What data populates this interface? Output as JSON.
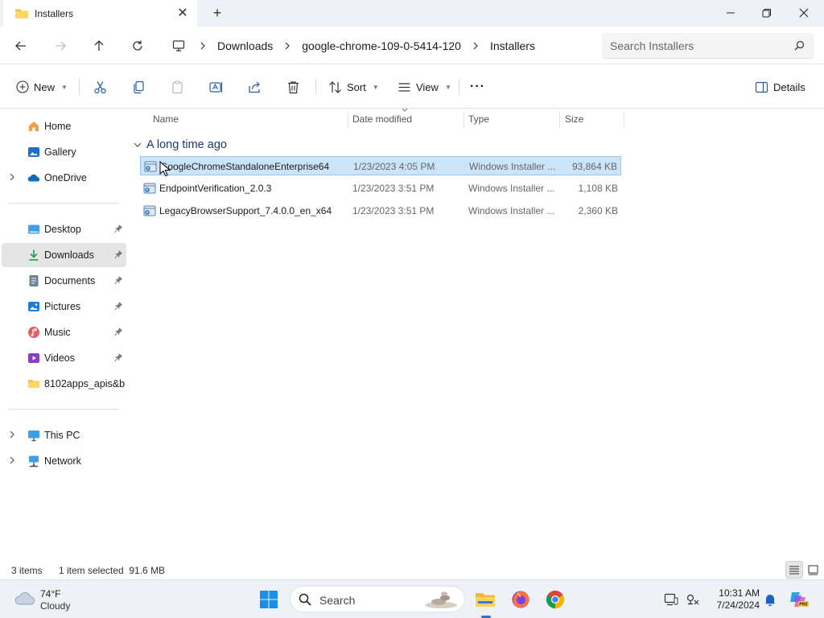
{
  "window": {
    "tab_title": "Installers",
    "tab_close": "✕",
    "new_tab": "+"
  },
  "address": {
    "breadcrumb": [
      "Downloads",
      "google-chrome-109-0-5414-120",
      "Installers"
    ],
    "search_placeholder": "Search Installers"
  },
  "toolbar": {
    "new_label": "New",
    "sort_label": "Sort",
    "view_label": "View",
    "details_label": "Details",
    "more_label": "···"
  },
  "sidebar": {
    "items": [
      {
        "label": "Home",
        "icon": "home-icon"
      },
      {
        "label": "Gallery",
        "icon": "gallery-icon"
      },
      {
        "label": "OneDrive",
        "icon": "onedrive-icon"
      },
      {
        "label": "Desktop",
        "icon": "desktop-icon"
      },
      {
        "label": "Downloads",
        "icon": "downloads-icon"
      },
      {
        "label": "Documents",
        "icon": "documents-icon"
      },
      {
        "label": "Pictures",
        "icon": "pictures-icon"
      },
      {
        "label": "Music",
        "icon": "music-icon"
      },
      {
        "label": "Videos",
        "icon": "videos-icon"
      },
      {
        "label": "8102apps_apis&bugs",
        "icon": "folder-icon"
      },
      {
        "label": "This PC",
        "icon": "this-pc-icon"
      },
      {
        "label": "Network",
        "icon": "network-icon"
      }
    ],
    "selected": "Downloads"
  },
  "file_list": {
    "columns": [
      "Name",
      "Date modified",
      "Type",
      "Size"
    ],
    "group_label": "A long time ago",
    "rows": [
      {
        "name": "GoogleChromeStandaloneEnterprise64",
        "date": "1/23/2023 4:05 PM",
        "type": "Windows Installer ...",
        "size": "93,864 KB",
        "selected": true
      },
      {
        "name": "EndpointVerification_2.0.3",
        "date": "1/23/2023 3:51 PM",
        "type": "Windows Installer ...",
        "size": "1,108 KB",
        "selected": false
      },
      {
        "name": "LegacyBrowserSupport_7.4.0.0_en_x64",
        "date": "1/23/2023 3:51 PM",
        "type": "Windows Installer ...",
        "size": "2,360 KB",
        "selected": false
      }
    ]
  },
  "status": {
    "item_count": "3 items",
    "selection": "1 item selected  91.6 MB"
  },
  "taskbar": {
    "weather_temp": "74°F",
    "weather_desc": "Cloudy",
    "search_label": "Search",
    "time": "10:31 AM",
    "date": "7/24/2024"
  },
  "colors": {
    "accent": "#0067c0",
    "selection_bg": "#cce4f7",
    "selection_border": "#99c9ef",
    "sidebar_selected": "#e5e5e5",
    "group_heading": "#1a3a6e"
  }
}
